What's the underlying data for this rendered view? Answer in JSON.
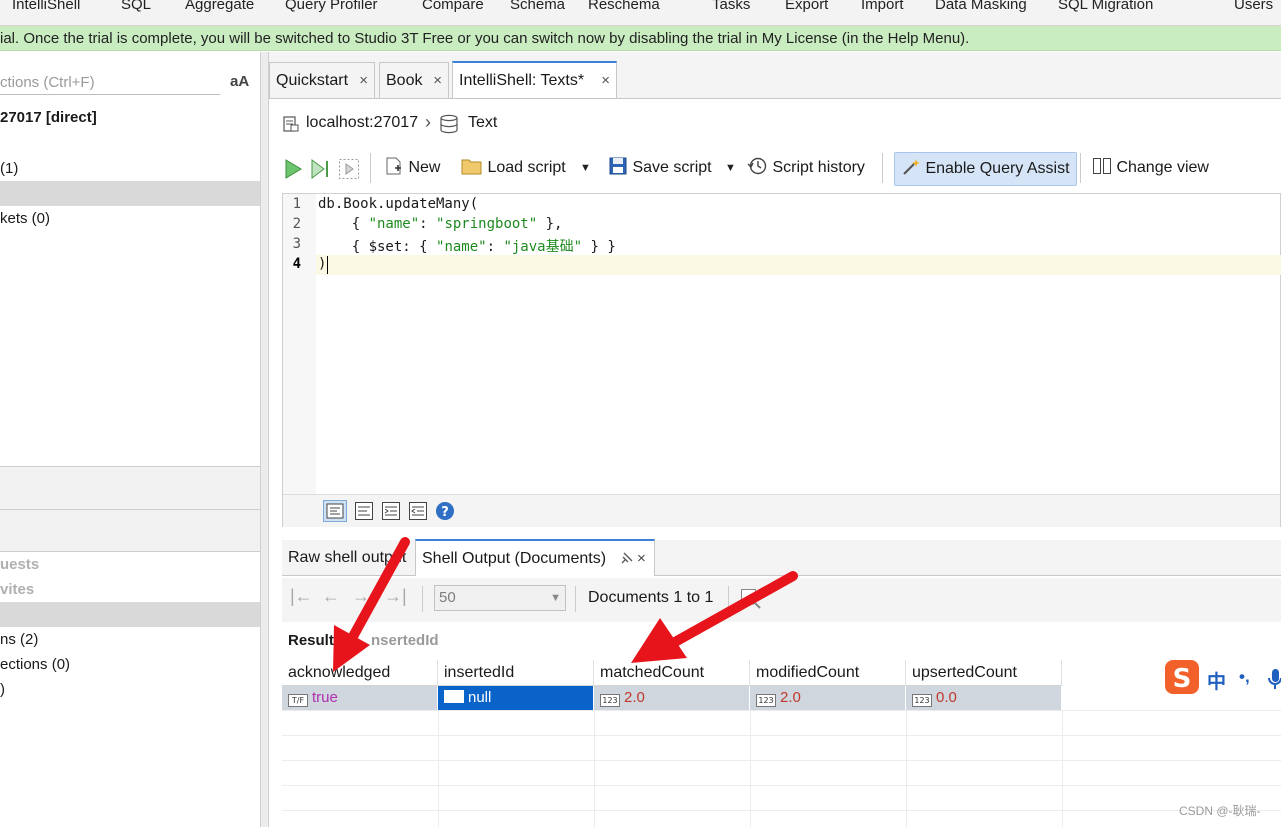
{
  "menubar": {
    "items": [
      "IntelliShell",
      "SQL",
      "Aggregate",
      "Query Profiler",
      "Compare",
      "Schema",
      "Reschema",
      "Tasks",
      "Export",
      "Import",
      "Data Masking",
      "SQL Migration",
      "Users"
    ]
  },
  "banner": {
    "text": "ial. Once the trial is complete, you will be switched to Studio 3T Free or you can switch now by disabling the trial in My License (in the Help Menu)."
  },
  "left": {
    "filter_placeholder": "ctions (Ctrl+F)",
    "font_toggle": "aA",
    "connection": "27017 [direct]",
    "items": [
      "(1)",
      "kets (0)"
    ],
    "section_items": [
      "uests",
      "vites"
    ],
    "bottom_items": [
      "ns (2)",
      "ections (0)",
      ")"
    ]
  },
  "tabs": [
    {
      "label": "Quickstart",
      "close": "×"
    },
    {
      "label": "Book",
      "close": "×"
    },
    {
      "label": "IntelliShell: Texts*",
      "close": "×"
    }
  ],
  "breadcrumb": {
    "host": "localhost:27017",
    "separator": "›",
    "collection": "Text"
  },
  "toolbar": {
    "new_label": "New",
    "load_label": "Load script",
    "save_label": "Save script",
    "history_label": "Script history",
    "assist_label": "Enable Query Assist",
    "view_label": "Change view"
  },
  "editor": {
    "lines": [
      {
        "num": "1",
        "text": "db.Book.updateMany("
      },
      {
        "num": "2",
        "pre": "    { ",
        "k": "\"name\"",
        "mid": ": ",
        "v": "\"springboot\"",
        "post": " },"
      },
      {
        "num": "3",
        "pre": "    { $set: { ",
        "k": "\"name\"",
        "mid": ": ",
        "v": "\"java基础\"",
        "post": " } }"
      },
      {
        "num": "4",
        "text": ")"
      }
    ]
  },
  "output": {
    "tabs": [
      {
        "label": "Raw shell output"
      },
      {
        "label": "Shell Output (Documents)",
        "close": "×"
      }
    ],
    "page_size": "50",
    "documents_text": "Documents 1 to 1",
    "result_label": "Result",
    "result_path": "nsertedId"
  },
  "table": {
    "columns": [
      "acknowledged",
      "insertedId",
      "matchedCount",
      "modifiedCount",
      "upsertedCount"
    ],
    "row": [
      {
        "icon": "T/F",
        "value": "true"
      },
      {
        "icon": "",
        "value": "null"
      },
      {
        "icon": "123",
        "value": "2.0"
      },
      {
        "icon": "123",
        "value": "2.0"
      },
      {
        "icon": "123",
        "value": "0.0"
      }
    ]
  },
  "ime": {
    "logo": "S",
    "lang": "中",
    "punct": "•,"
  },
  "watermark": "CSDN @-耿瑞-",
  "colors": {
    "accent": "#3b82d6",
    "banner": "#c9ecc1",
    "selection": "#0a63c9",
    "string": "#1f8a1f",
    "number": "#c0392b",
    "boolean": "#b02fb0",
    "arrow": "#e8141c"
  }
}
